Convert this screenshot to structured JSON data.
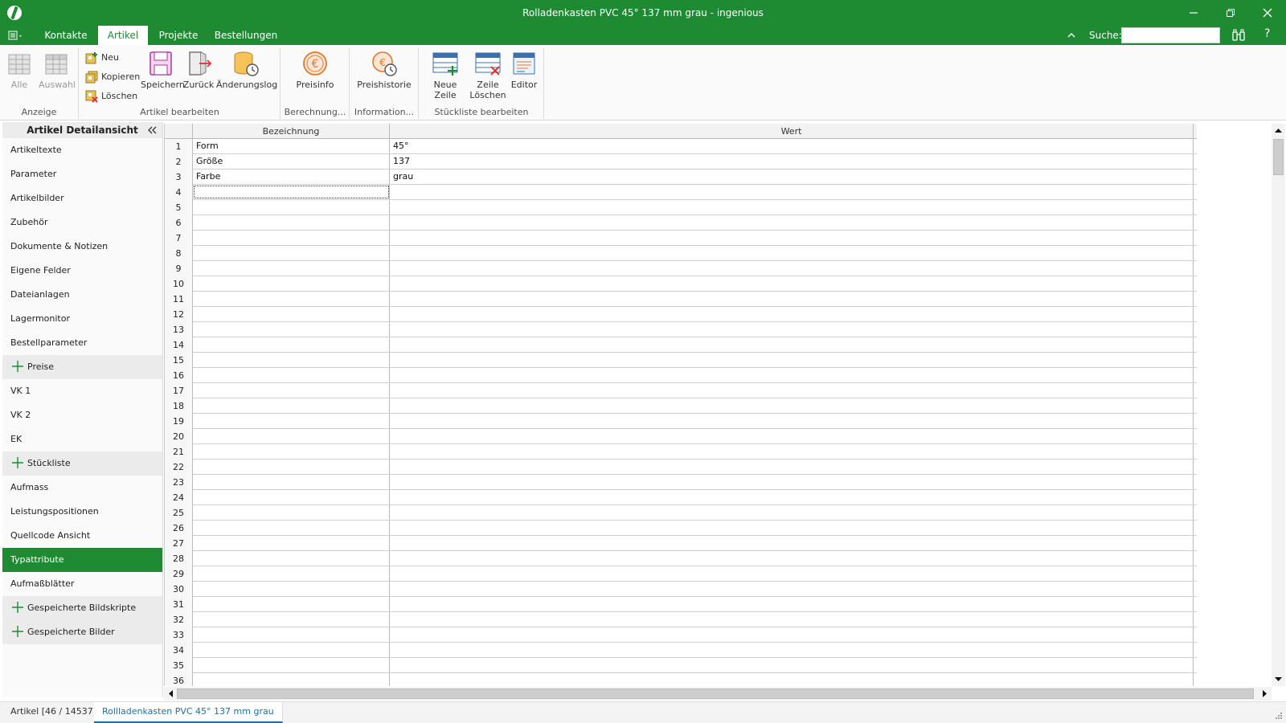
{
  "window": {
    "title": "Rolladenkasten PVC 45° 137 mm grau - ingenious"
  },
  "ribbon_tabs": [
    {
      "label": "Kontakte",
      "active": false
    },
    {
      "label": "Artikel",
      "active": true
    },
    {
      "label": "Projekte",
      "active": false
    },
    {
      "label": "Bestellungen",
      "active": false
    }
  ],
  "search": {
    "label": "Suche:",
    "value": ""
  },
  "help_label": "?",
  "ribbon": {
    "anzeige": {
      "label": "Anzeige",
      "alle": "Alle",
      "auswahl": "Auswahl"
    },
    "artikel_bearbeiten": {
      "label": "Artikel bearbeiten",
      "neu": "Neu",
      "kopieren": "Kopieren",
      "loeschen": "Löschen",
      "speichern": "Speichern",
      "zurueck": "Zurück",
      "aenderungslog": "Änderungslog"
    },
    "berechnung": {
      "label": "Berechnung...",
      "preisinfo": "Preisinfo"
    },
    "information": {
      "label": "Information...",
      "preishistorie": "Preishistorie"
    },
    "stueckliste": {
      "label": "Stückliste bearbeiten",
      "neue_zeile": "Neue Zeile",
      "zeile_loeschen_1": "Zeile",
      "zeile_loeschen_2": "Löschen",
      "editor": "Editor"
    }
  },
  "sidebar": {
    "title": "Artikel Detailansicht",
    "items": [
      {
        "label": "Artikeltexte",
        "type": "item"
      },
      {
        "label": "Parameter",
        "type": "item"
      },
      {
        "label": "Artikelbilder",
        "type": "item"
      },
      {
        "label": "Zubehör",
        "type": "item"
      },
      {
        "label": "Dokumente & Notizen",
        "type": "item"
      },
      {
        "label": "Eigene Felder",
        "type": "item"
      },
      {
        "label": "Dateianlagen",
        "type": "item"
      },
      {
        "label": "Lagermonitor",
        "type": "item"
      },
      {
        "label": "Bestellparameter",
        "type": "item"
      },
      {
        "label": "Preise",
        "type": "group"
      },
      {
        "label": "VK 1",
        "type": "item"
      },
      {
        "label": "VK 2",
        "type": "item"
      },
      {
        "label": "EK",
        "type": "item"
      },
      {
        "label": "Stückliste",
        "type": "group"
      },
      {
        "label": "Aufmass",
        "type": "item"
      },
      {
        "label": "Leistungspositionen",
        "type": "item"
      },
      {
        "label": "Quellcode Ansicht",
        "type": "item"
      },
      {
        "label": "Typattribute",
        "type": "active"
      },
      {
        "label": "Aufmaßblätter",
        "type": "item"
      },
      {
        "label": "Gespeicherte Bildskripte",
        "type": "group"
      },
      {
        "label": "Gespeicherte Bilder",
        "type": "group"
      }
    ]
  },
  "grid": {
    "columns": [
      "Bezeichnung",
      "Wert"
    ],
    "row_count": 36,
    "rows": [
      {
        "bezeichnung": "Form",
        "wert": "45°"
      },
      {
        "bezeichnung": "Größe",
        "wert": "137"
      },
      {
        "bezeichnung": "Farbe",
        "wert": "grau"
      }
    ],
    "focused_row": 4
  },
  "bottom_tabs": [
    {
      "label": "Artikel [46 / 14537]",
      "active": false
    },
    {
      "label": "Rollladenkasten PVC 45° 137 mm grau",
      "active": true
    }
  ],
  "colors": {
    "brand": "#1e8a32",
    "active_tab_text": "#1a6fb0"
  }
}
